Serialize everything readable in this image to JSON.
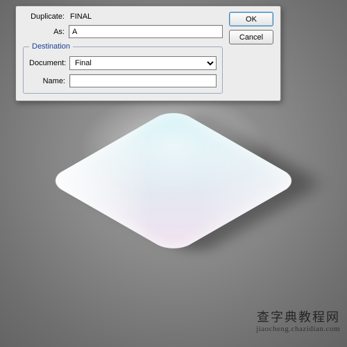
{
  "dialog": {
    "duplicate_label": "Duplicate:",
    "duplicate_value": "FINAL",
    "as_label": "As:",
    "as_value": "A",
    "destination_legend": "Destination",
    "document_label": "Document:",
    "document_value": "Final",
    "name_label": "Name:",
    "name_value": "",
    "ok_label": "OK",
    "cancel_label": "Cancel"
  },
  "watermark": {
    "line1": "查字典教程网",
    "line2": "jiaocheng.chazidian.com"
  }
}
